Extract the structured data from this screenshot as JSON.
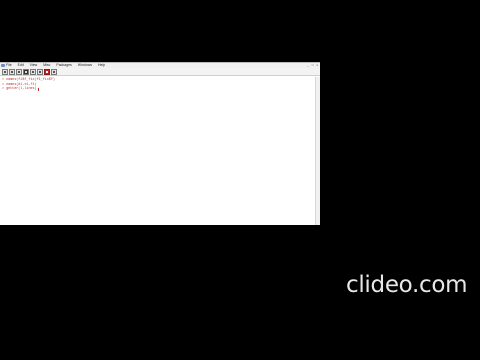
{
  "menubar": {
    "items": [
      "File",
      "Edit",
      "View",
      "Misc",
      "Packages",
      "Windows",
      "Help"
    ]
  },
  "window_controls": [
    "_",
    "□",
    "x"
  ],
  "toolbar": {
    "buttons": [
      "open-script-icon",
      "load-workspace-icon",
      "save-icon",
      "copy-icon",
      "paste-icon",
      "copy-paste-icon",
      "stop-icon",
      "print-icon"
    ]
  },
  "console": {
    "lines": [
      "> names(f1$f_fix(f1_fix$f)",
      "> names(d1,x1,f1)",
      "> getter(l,lines)"
    ]
  },
  "watermark": {
    "text": "clideo.com"
  },
  "colors": {
    "background": "#000000",
    "console_text": "#c62828",
    "window": "#ffffff"
  }
}
